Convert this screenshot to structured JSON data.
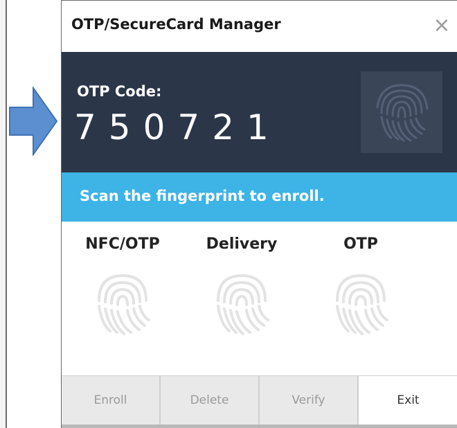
{
  "window": {
    "title": "OTP/SecureCard Manager",
    "close_glyph": "×"
  },
  "otp": {
    "label": "OTP Code:",
    "code": "750721"
  },
  "banner": {
    "text": "Scan the fingerprint to enroll."
  },
  "fingerprints": [
    {
      "label": "NFC/OTP"
    },
    {
      "label": "Delivery"
    },
    {
      "label": "OTP"
    }
  ],
  "buttons": {
    "enroll": "Enroll",
    "delete": "Delete",
    "verify": "Verify",
    "exit": "Exit"
  },
  "colors": {
    "otp_panel": "#2b3649",
    "banner": "#3db3e6",
    "arrow": "#5b8fd0"
  },
  "icons": [
    "arrow-right-icon",
    "close-icon",
    "fingerprint-icon"
  ]
}
